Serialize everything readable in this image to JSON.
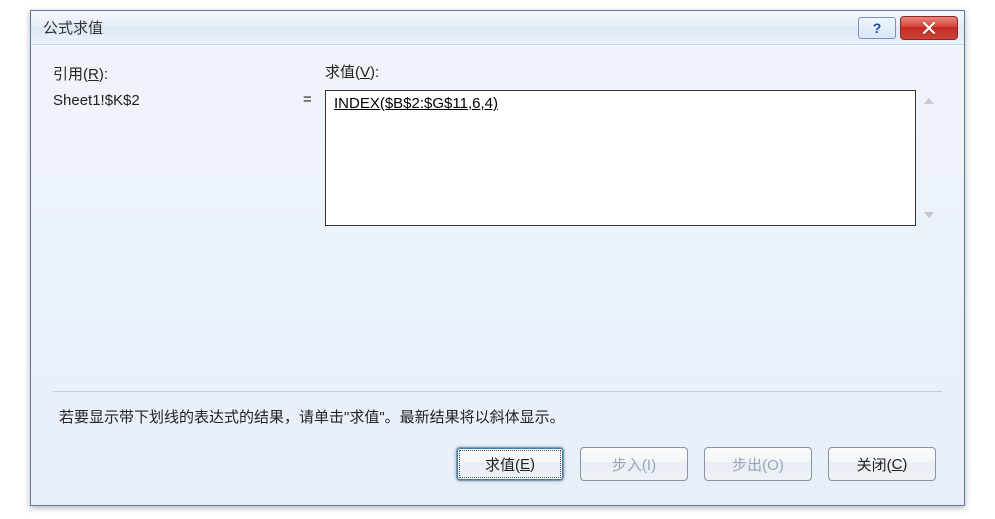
{
  "dialog": {
    "title": "公式求值"
  },
  "labels": {
    "reference": "引用(",
    "reference_accel": "R",
    "reference_suffix": "):",
    "evaluation": "求值(",
    "evaluation_accel": "V",
    "evaluation_suffix": "):"
  },
  "values": {
    "reference_cell": "Sheet1!$K$2",
    "equals": "=",
    "formula": "INDEX($B$2:$G$11,6,4)"
  },
  "hint": "若要显示带下划线的表达式的结果，请单击\"求值\"。最新结果将以斜体显示。",
  "buttons": {
    "evaluate": "求值(",
    "evaluate_accel": "E",
    "evaluate_suffix": ")",
    "stepin": "步入(I)",
    "stepout": "步出(O)",
    "close": "关闭(",
    "close_accel": "C",
    "close_suffix": ")"
  },
  "controls": {
    "help_glyph": "?"
  }
}
